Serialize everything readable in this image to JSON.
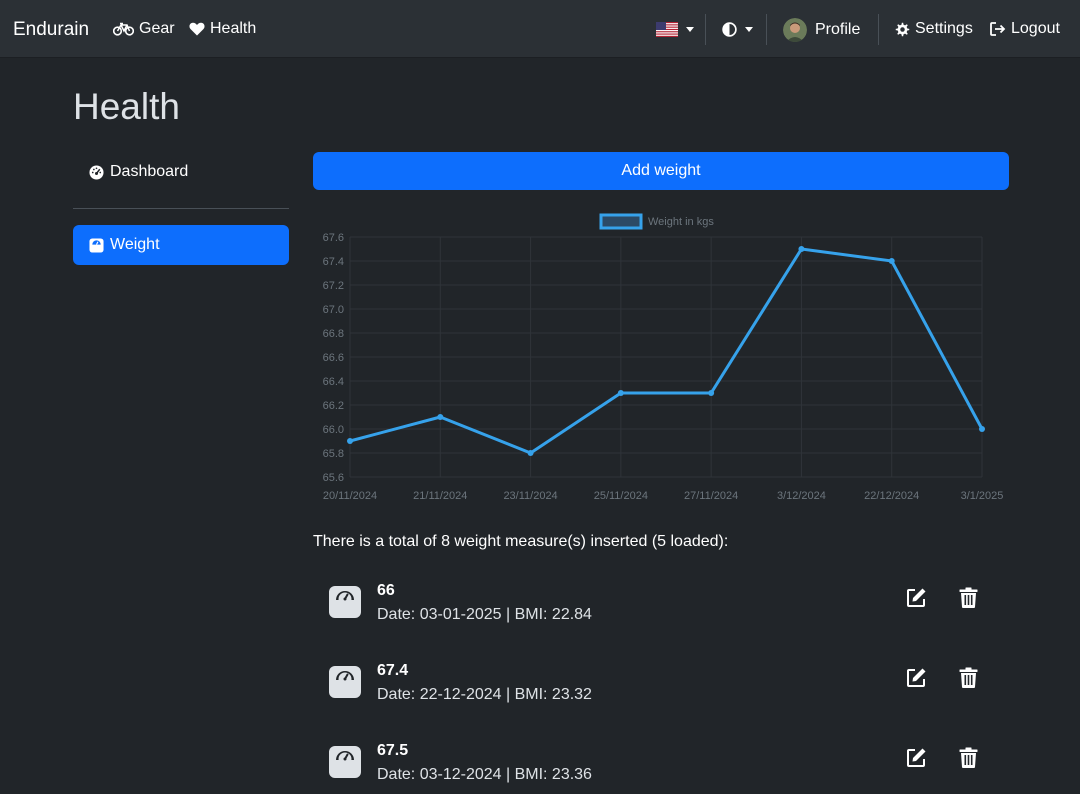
{
  "navbar": {
    "brand": "Endurain",
    "gear": "Gear",
    "health": "Health",
    "profile": "Profile",
    "settings": "Settings",
    "logout": "Logout"
  },
  "page": {
    "title": "Health"
  },
  "sidebar": {
    "items": [
      {
        "label": "Dashboard",
        "icon": "gauge-icon",
        "active": false
      },
      {
        "label": "Weight",
        "icon": "weight-scale-icon",
        "active": true
      }
    ]
  },
  "main": {
    "add_button": "Add weight",
    "summary": "There is a total of 8 weight measure(s) inserted (5 loaded):",
    "entries": [
      {
        "value": "66",
        "detail": "Date: 03-01-2025 | BMI: 22.84"
      },
      {
        "value": "67.4",
        "detail": "Date: 22-12-2024 | BMI: 23.32"
      },
      {
        "value": "67.5",
        "detail": "Date: 03-12-2024 | BMI: 23.36"
      }
    ]
  },
  "colors": {
    "accent": "#0d6efd",
    "line": "#36a2eb",
    "background": "#212529",
    "navbar": "#2b3035"
  },
  "chart_data": {
    "type": "line",
    "categories": [
      "20/11/2024",
      "21/11/2024",
      "23/11/2024",
      "25/11/2024",
      "27/11/2024",
      "3/12/2024",
      "22/12/2024",
      "3/1/2025"
    ],
    "series": [
      {
        "name": "Weight in kgs",
        "values": [
          65.9,
          66.1,
          65.8,
          66.3,
          66.3,
          67.5,
          67.4,
          66.0
        ]
      }
    ],
    "yticks": [
      "67.6",
      "67.4",
      "67.2",
      "67.0",
      "66.8",
      "66.6",
      "66.4",
      "66.2",
      "66.0",
      "65.8",
      "65.6"
    ],
    "ylim": [
      65.6,
      67.6
    ],
    "grid": true,
    "legend": "top-center"
  }
}
